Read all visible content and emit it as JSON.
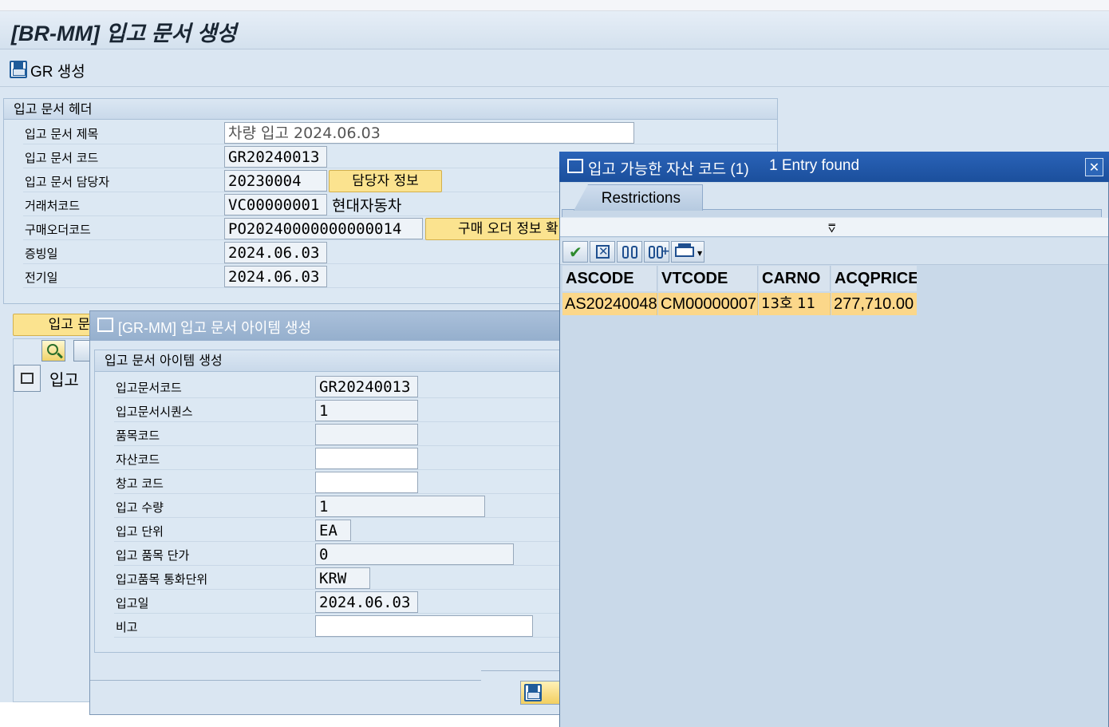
{
  "main": {
    "title": "[BR-MM] 입고 문서 생성",
    "toolbar": {
      "gr_create": "GR 생성"
    },
    "header_group": {
      "title": "입고 문서 헤더",
      "fields": [
        {
          "label": "입고 문서 제목",
          "value": "차량 입고 2024.06.03"
        },
        {
          "label": "입고 문서 코드",
          "value": "GR20240013"
        },
        {
          "label": "입고 문서 담당자",
          "value": "20230004"
        },
        {
          "label": "거래처코드",
          "value": "VC00000001",
          "extra": "현대자동차"
        },
        {
          "label": "구매오더코드",
          "value": "PO20240000000000014"
        },
        {
          "label": "증빙일",
          "value": "2024.06.03"
        },
        {
          "label": "전기일",
          "value": "2024.06.03"
        }
      ],
      "manager_info_button": "담당자 정보",
      "po_info_button": "구매 오더 정보 확"
    },
    "item_button_partial": "입고 문",
    "item_table_partial": "입고"
  },
  "item_dialog": {
    "title": "[GR-MM] 입고 문서 아이템 생성",
    "group_title": "입고 문서 아이템 생성",
    "fields": [
      {
        "label": "입고문서코드",
        "value": "GR20240013"
      },
      {
        "label": "입고문서시퀀스",
        "value": "1"
      },
      {
        "label": "품목코드",
        "value": ""
      },
      {
        "label": "자산코드",
        "value": ""
      },
      {
        "label": "창고 코드",
        "value": ""
      },
      {
        "label": "입고 수량",
        "value": "1"
      },
      {
        "label": "입고 단위",
        "value": "EA"
      },
      {
        "label": "입고 품목 단가",
        "value": "0"
      },
      {
        "label": "입고품목 통화단위",
        "value": "KRW"
      },
      {
        "label": "입고일",
        "value": "2024.06.03"
      },
      {
        "label": "비고",
        "value": ""
      }
    ]
  },
  "popup": {
    "title": "입고 가능한 자산 코드 (1)",
    "entries_found": "1 Entry found",
    "tab_restrictions": "Restrictions",
    "columns": [
      "ASCODE",
      "VTCODE",
      "CARNO",
      "ACQPRICE"
    ],
    "rows": [
      {
        "ascode": "AS20240048",
        "vtcode": "CM00000007",
        "carno": "13호 11",
        "acqprice": "277,710.00"
      }
    ]
  },
  "colors": {
    "screen_bg": "#dae6f2",
    "popup_title": "#1b4f9c",
    "button_yellow": "#fbe38f",
    "selected_row": "#fbd78a"
  }
}
